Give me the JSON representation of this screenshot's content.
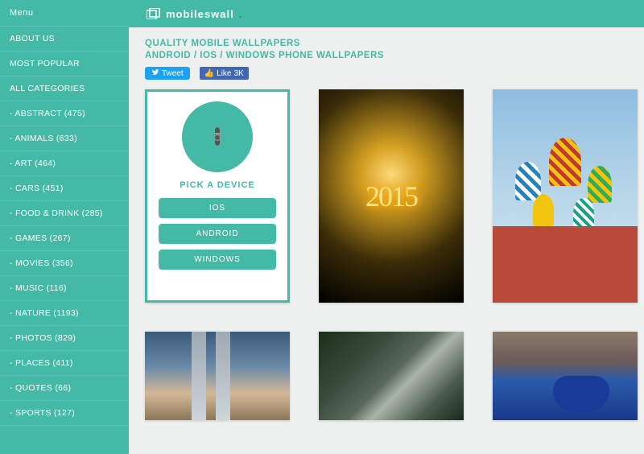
{
  "sidebar": {
    "menu_label": "Menu",
    "nav": [
      {
        "label": "ABOUT US"
      },
      {
        "label": "MOST POPULAR"
      },
      {
        "label": "ALL CATEGORIES"
      },
      {
        "label": "- ABSTRACT (475)"
      },
      {
        "label": "- ANIMALS (633)"
      },
      {
        "label": "- ART (464)"
      },
      {
        "label": "- CARS (451)"
      },
      {
        "label": "- FOOD & DRINK (285)"
      },
      {
        "label": "- GAMES (267)"
      },
      {
        "label": "- MOVIES (356)"
      },
      {
        "label": "- MUSIC (116)"
      },
      {
        "label": "- NATURE (1193)"
      },
      {
        "label": "- PHOTOS (829)"
      },
      {
        "label": "- PLACES (411)"
      },
      {
        "label": "- QUOTES (66)"
      },
      {
        "label": "- SPORTS (127)"
      }
    ]
  },
  "brand": {
    "name": "mobileswall",
    "dot": "."
  },
  "headings": {
    "line1": "QUALITY MOBILE WALLPAPERS",
    "line2": "ANDROID / IOS / WINDOWS PHONE WALLPAPERS"
  },
  "social": {
    "tweet": "Tweet",
    "fb_like": "Like",
    "fb_count": "3K"
  },
  "picker": {
    "title": "PICK A DEVICE",
    "buttons": [
      {
        "label": "IOS"
      },
      {
        "label": "ANDROID"
      },
      {
        "label": "WINDOWS"
      }
    ]
  },
  "colors": {
    "accent": "#44b9a6",
    "twitter": "#1da1f2",
    "facebook": "#4267B2"
  }
}
